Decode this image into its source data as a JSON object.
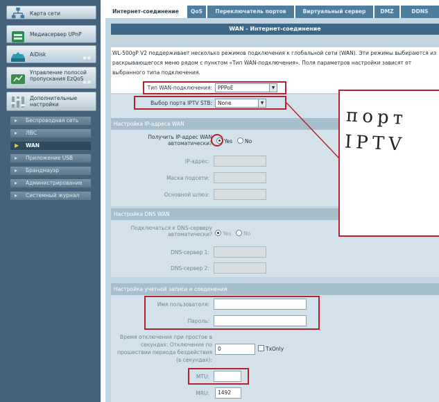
{
  "sidebar": {
    "big_items": [
      {
        "label": "Карта сети",
        "icon": "network-map-icon"
      },
      {
        "label": "Медиасервер UPnP",
        "icon": "media-server-icon"
      },
      {
        "label": "AiDisk",
        "icon": "aidisk-icon"
      },
      {
        "label": "Управление полосой пропускания EzQoS",
        "icon": "ezqos-icon"
      },
      {
        "label": "Дополнительные настройки",
        "icon": "advanced-settings-icon"
      }
    ],
    "sub_items": [
      {
        "label": "Беспроводная сеть"
      },
      {
        "label": "ЛВС"
      },
      {
        "label": "WAN"
      },
      {
        "label": "Приложение USB"
      },
      {
        "label": "Брандмауэр"
      },
      {
        "label": "Администрирование"
      },
      {
        "label": "Системный журнал"
      }
    ]
  },
  "tabs": [
    {
      "label": "Интернет-соединение"
    },
    {
      "label": "QoS"
    },
    {
      "label": "Переключатель портов"
    },
    {
      "label": "Виртуальный сервер"
    },
    {
      "label": "DMZ"
    },
    {
      "label": "DDNS"
    }
  ],
  "page": {
    "title": "WAN - Интернет-соединение",
    "intro": "WL-500gP V2 поддерживает несколько режимов подключения к глобальной сети (WAN). Эти режимы выбираются из раскрывающегося меню рядом с пунктом «Тип WAN-подключения». Поля параметров настройки зависят от выбранного типа подключения."
  },
  "wan_type": {
    "label": "Тип WAN-подключения:",
    "value": "PPPoE"
  },
  "iptv_port": {
    "label": "Выбор порта IPTV STB:",
    "value": "None"
  },
  "ip_section": {
    "title": "Настройка IP-адреса WAN",
    "auto_label": "Получить IP-адрес WAN автоматически?",
    "yes": "Yes",
    "no": "No",
    "ip_label": "IP-адрес:",
    "mask_label": "Маска подсети:",
    "gateway_label": "Основной шлюз:"
  },
  "dns_section": {
    "title": "Настройка DNS WAN",
    "auto_label": "Подключаться к DNS-серверу автоматически?",
    "yes": "Yes",
    "no": "No",
    "dns1_label": "DNS-сервер 1:",
    "dns2_label": "DNS-сервер 2:"
  },
  "account_section": {
    "title": "Настройка учетной записи и соединения",
    "user_label": "Имя пользователя:",
    "password_label": "Пароль:",
    "idle_label": "Время отключения при простое в секундах: Отключение по прошествии периода бездействия (в секундах):",
    "idle_value": "0",
    "tx_only": "TxOnly",
    "mtu_label": "MTU:",
    "mru_label": "MRU:",
    "mru_value": "1492"
  },
  "annotation": {
    "handwritten": "порт IPTV"
  },
  "colors": {
    "sidebar_bg": "#45627a",
    "tab_bg": "#4e7e9e",
    "banner_bg": "#3e6785",
    "panel_bg": "#c2d5e0",
    "highlight_red": "#b4222e"
  }
}
